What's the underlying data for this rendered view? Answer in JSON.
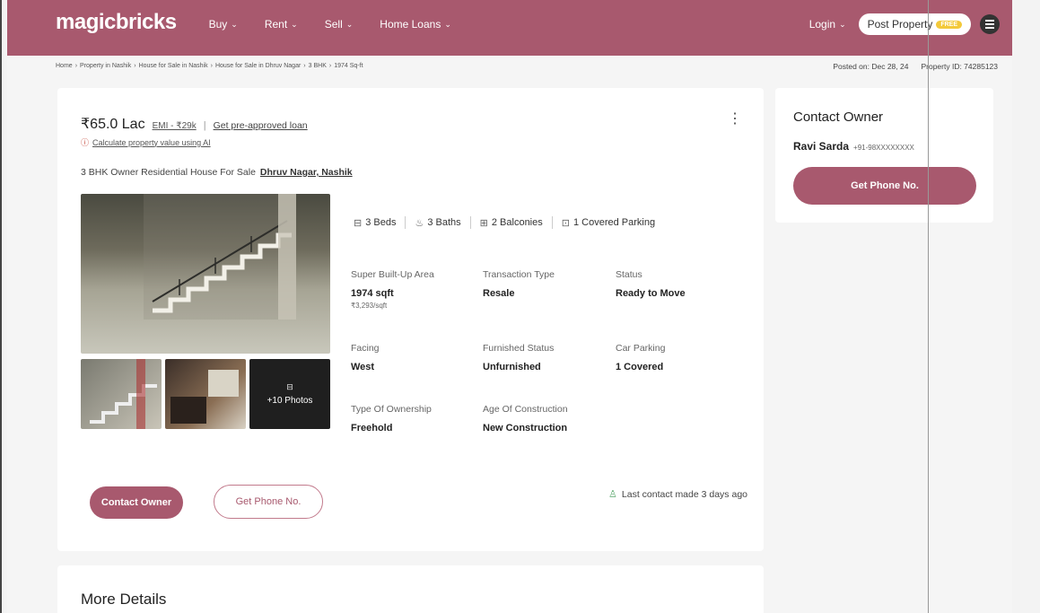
{
  "header": {
    "logo": "magicbricks",
    "nav": [
      {
        "label": "Buy"
      },
      {
        "label": "Rent"
      },
      {
        "label": "Sell"
      },
      {
        "label": "Home Loans"
      }
    ],
    "login": "Login",
    "post_property": "Post Property",
    "free_badge": "FREE",
    "brand_color": "#a8596e"
  },
  "breadcrumb": {
    "items": [
      "Home",
      "Property in Nashik",
      "House for Sale in Nashik",
      "House for Sale in Dhruv Nagar",
      "3 BHK",
      "1974 Sq-ft"
    ],
    "separator": "›"
  },
  "meta": {
    "posted_on": "Posted on: Dec 28, 24",
    "property_id": "Property ID: 74285123"
  },
  "listing": {
    "price": "₹65.0 Lac",
    "emi": "EMI - ₹29k",
    "preapproved": "Get pre-approved loan",
    "calc_value": "Calculate property value using AI",
    "title": "3 BHK Owner Residential House For Sale",
    "location": "Dhruv Nagar, Nashik",
    "more_photos": "+10 Photos",
    "amenities": [
      {
        "icon": "bed-icon",
        "label": "3 Beds"
      },
      {
        "icon": "bath-icon",
        "label": "3 Baths"
      },
      {
        "icon": "balcony-icon",
        "label": "2 Balconies"
      },
      {
        "icon": "parking-icon",
        "label": "1 Covered Parking"
      }
    ],
    "specs": {
      "area": {
        "label": "Super Built-Up Area",
        "value": "1974 sqft",
        "sub": "₹3,293/sqft"
      },
      "transaction": {
        "label": "Transaction Type",
        "value": "Resale"
      },
      "status": {
        "label": "Status",
        "value": "Ready to Move"
      },
      "facing": {
        "label": "Facing",
        "value": "West"
      },
      "furnished": {
        "label": "Furnished Status",
        "value": "Unfurnished"
      },
      "car_parking": {
        "label": "Car Parking",
        "value": "1 Covered"
      },
      "ownership": {
        "label": "Type Of Ownership",
        "value": "Freehold"
      },
      "age": {
        "label": "Age Of Construction",
        "value": "New Construction"
      }
    },
    "contact_owner_btn": "Contact Owner",
    "get_phone_btn": "Get Phone No.",
    "last_contact": "Last contact made 3 days ago"
  },
  "more_details": {
    "title": "More Details"
  },
  "contact_card": {
    "title": "Contact Owner",
    "owner_name": "Ravi Sarda",
    "owner_phone": "+91-98XXXXXXXX",
    "button": "Get Phone No."
  }
}
